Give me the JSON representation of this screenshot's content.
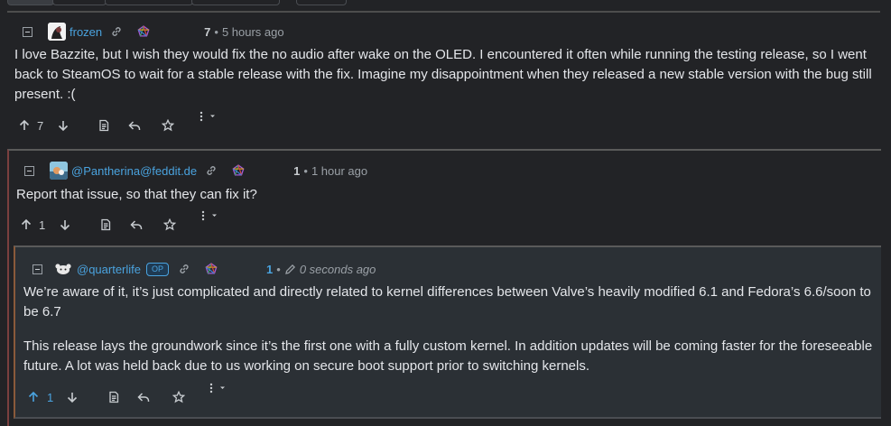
{
  "comments": [
    {
      "user": "frozen",
      "is_op": false,
      "score": "7",
      "separator": "•",
      "time": "5 hours ago",
      "edited": false,
      "paragraphs": [
        "I love Bazzite, but I wish they would fix the no audio after wake on the OLED. I encountered it often while running the testing release, so I went back to SteamOS to wait for a stable release with the fix. Imagine my disappointment when they released a new stable version with the bug still present. :("
      ],
      "upvotes": "7"
    },
    {
      "user": "@Pantherina@feddit.de",
      "is_op": false,
      "score": "1",
      "separator": "•",
      "time": "1 hour ago",
      "edited": false,
      "paragraphs": [
        "Report that issue, so that they can fix it?"
      ],
      "upvotes": "1"
    },
    {
      "user": "@quarterlife",
      "is_op": true,
      "op_label": "OP",
      "score": "1",
      "separator": "•",
      "time": "0 seconds ago",
      "edited": true,
      "paragraphs": [
        "We’re aware of it, it’s just complicated and directly related to kernel differences between Valve’s heavily modified 6.1 and Fedora’s 6.6/soon to be 6.7",
        "This release lays the groundwork since it’s the first one with a fully custom kernel. In addition updates will be coming faster for the foreseeable future. A lot was held back due to us working on secure boot support prior to switching kernels."
      ],
      "upvotes": "1",
      "upvoted": true
    }
  ],
  "icons": {
    "collapse": "minus-square-icon",
    "link": "link-icon",
    "federated": "fediverse-icon",
    "upvote": "arrow-up-icon",
    "downvote": "arrow-down-icon",
    "source": "file-text-icon",
    "reply": "reply-icon",
    "save": "star-icon",
    "more": "more-vertical-icon",
    "edited": "pencil-icon"
  },
  "colors": {
    "background": "#222326",
    "nested_background": "#2b3035",
    "link": "#4aa3df",
    "text": "#e4e6ea",
    "muted": "#9aa0a6"
  }
}
